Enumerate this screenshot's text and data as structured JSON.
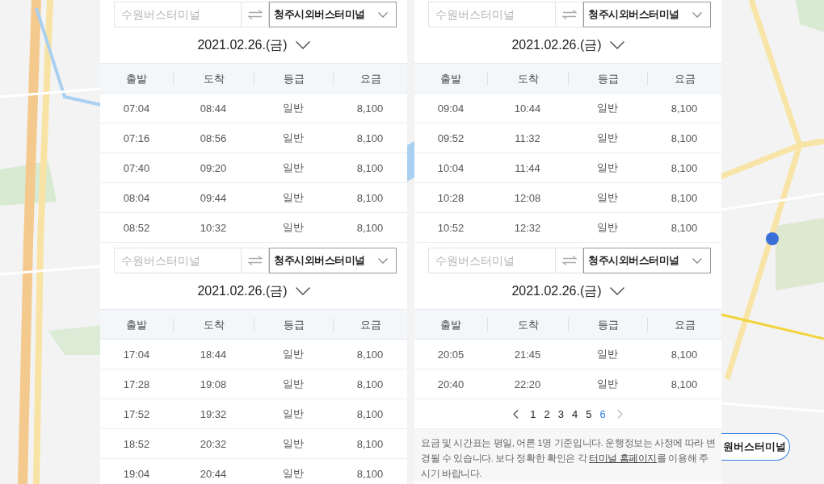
{
  "panels": [
    {
      "sections": [
        {
          "from_placeholder": "수원버스터미널",
          "to": "청주시외버스터미널",
          "date": "2021.02.26.(금)",
          "columns": [
            "출발",
            "도착",
            "등급",
            "요금"
          ],
          "rows": [
            [
              "07:04",
              "08:44",
              "일반",
              "8,100"
            ],
            [
              "07:16",
              "08:56",
              "일반",
              "8,100"
            ],
            [
              "07:40",
              "09:20",
              "일반",
              "8,100"
            ],
            [
              "08:04",
              "09:44",
              "일반",
              "8,100"
            ],
            [
              "08:52",
              "10:32",
              "일반",
              "8,100"
            ]
          ]
        },
        {
          "from_placeholder": "수원버스터미널",
          "to": "청주시외버스터미널",
          "date": "2021.02.26.(금)",
          "columns": [
            "출발",
            "도착",
            "등급",
            "요금"
          ],
          "rows": [
            [
              "17:04",
              "18:44",
              "일반",
              "8,100"
            ],
            [
              "17:28",
              "19:08",
              "일반",
              "8,100"
            ],
            [
              "17:52",
              "19:32",
              "일반",
              "8,100"
            ],
            [
              "18:52",
              "20:32",
              "일반",
              "8,100"
            ],
            [
              "19:04",
              "20:44",
              "일반",
              "8,100"
            ]
          ]
        }
      ]
    },
    {
      "sections": [
        {
          "from_placeholder": "수원버스터미널",
          "to": "청주시외버스터미널",
          "date": "2021.02.26.(금)",
          "columns": [
            "출발",
            "도착",
            "등급",
            "요금"
          ],
          "rows": [
            [
              "09:04",
              "10:44",
              "일반",
              "8,100"
            ],
            [
              "09:52",
              "11:32",
              "일반",
              "8,100"
            ],
            [
              "10:04",
              "11:44",
              "일반",
              "8,100"
            ],
            [
              "10:28",
              "12:08",
              "일반",
              "8,100"
            ],
            [
              "10:52",
              "12:32",
              "일반",
              "8,100"
            ]
          ]
        },
        {
          "from_placeholder": "수원버스터미널",
          "to": "청주시외버스터미널",
          "date": "2021.02.26.(금)",
          "columns": [
            "출발",
            "도착",
            "등급",
            "요금"
          ],
          "rows": [
            [
              "20:05",
              "21:45",
              "일반",
              "8,100"
            ],
            [
              "20:40",
              "22:20",
              "일반",
              "8,100"
            ]
          ]
        }
      ],
      "pagination": {
        "pages": [
          {
            "label": "1",
            "selected": false
          },
          {
            "label": "2",
            "selected": false
          },
          {
            "label": "3",
            "selected": false
          },
          {
            "label": "4",
            "selected": false
          },
          {
            "label": "5",
            "selected": false
          },
          {
            "label": "6",
            "selected": true
          }
        ]
      },
      "notice": {
        "before": "요금 및 시간표는 평일, 어른 1명 기준입니다. 운행정보는 사정에 따라 변경될 수 있습니다. 보다 정확한 확인은 각 ",
        "link": "터미널 홈페이지",
        "after": "를 이용해 주시기 바랍니다."
      }
    }
  ],
  "map_button": {
    "label": "원버스터미널"
  }
}
